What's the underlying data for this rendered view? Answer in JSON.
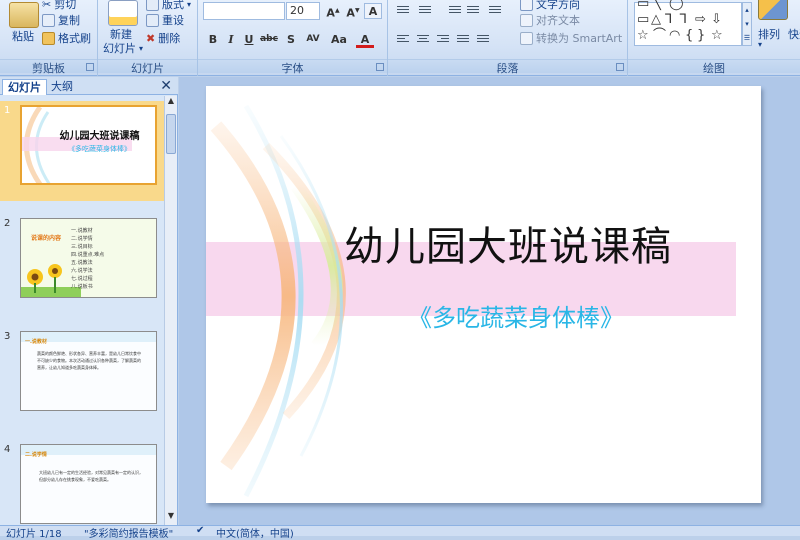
{
  "ribbon": {
    "clipboard": {
      "label": "剪贴板",
      "paste": "粘贴",
      "cut": "剪切",
      "copy": "复制",
      "format_painter": "格式刷"
    },
    "slides": {
      "label": "幻灯片",
      "new_slide_line1": "新建",
      "new_slide_line2": "幻灯片",
      "layout": "版式",
      "reset": "重设",
      "delete": "删除"
    },
    "font": {
      "label": "字体",
      "font_name": "",
      "font_size": "20",
      "bold": "B",
      "italic": "I",
      "underline": "U",
      "strike": "abc",
      "shadow": "S",
      "spacing": "AV",
      "case": "Aa",
      "color": "A"
    },
    "paragraph": {
      "label": "段落",
      "text_direction": "文字方向",
      "align_text": "对齐文本",
      "smartart": "转换为 SmartArt"
    },
    "drawing": {
      "label": "绘图",
      "arrange": "排列",
      "quick_styles": "快速"
    }
  },
  "left_pane": {
    "tab_slides": "幻灯片",
    "tab_outline": "大纲",
    "close": "✕",
    "thumbnails": [
      {
        "number": "1",
        "title": "幼儿园大班说课稿",
        "subtitle": "《多吃蔬菜身体棒》"
      },
      {
        "number": "2",
        "heading": "说课的内容",
        "items": [
          "一.说教材",
          "二.说学情",
          "三.说目标",
          "四.说重点.难点",
          "五.说教法",
          "六.说学法",
          "七.说过程",
          "八.说板书"
        ]
      },
      {
        "number": "3",
        "heading": "一.说教材",
        "body": "蔬菜的颜色鲜艳、形状各异、营养丰富，是幼儿日常饮食中不可缺少的食物。本次活动通过认识各种蔬菜，了解蔬菜的营养，让幼儿知道多吃蔬菜身体棒。"
      },
      {
        "number": "4",
        "heading": "二.说学情",
        "body": "大班幼儿已有一定的生活经验，对常见蔬菜有一定的认识，但部分幼儿存在挑食现象，不爱吃蔬菜。"
      }
    ]
  },
  "slide": {
    "title": "幼儿园大班说课稿",
    "subtitle": "《多吃蔬菜身体棒》"
  },
  "status_bar": {
    "slide_count": "幻灯片 1/18",
    "theme": "\"多彩简约报告模板\"",
    "language": "中文(简体，中国)"
  },
  "colors": {
    "subtitle": "#29b6e6",
    "selection": "#f9d98b",
    "ribbon_text": "#15428b"
  }
}
